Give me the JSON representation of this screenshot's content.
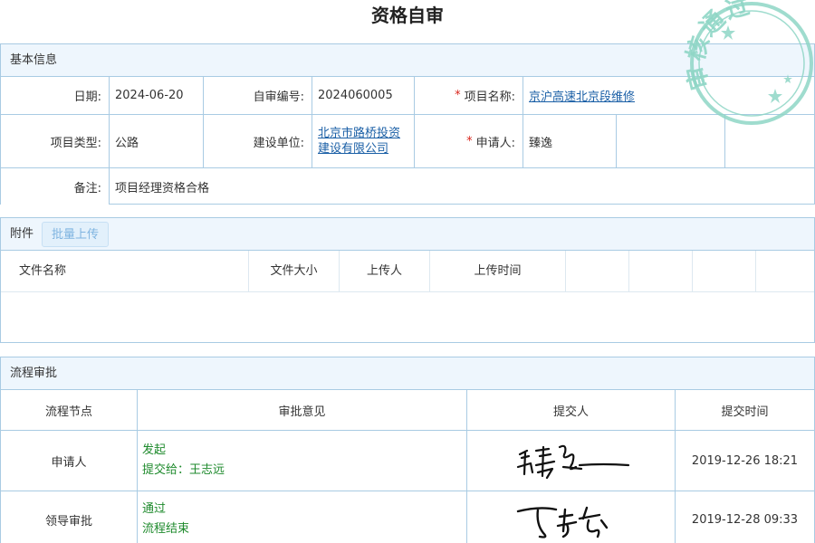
{
  "page": {
    "title": "资格自审"
  },
  "basic_info": {
    "header": "基本信息",
    "date_label": "日期:",
    "date_value": "2024-06-20",
    "code_label": "自审编号:",
    "code_value": "2024060005",
    "project_name_label": "项目名称:",
    "project_name_value": "京沪高速北京段维修",
    "project_type_label": "项目类型:",
    "project_type_value": "公路",
    "builder_label": "建设单位:",
    "builder_value": "北京市路桥投资建设有限公司",
    "applicant_label": "申请人:",
    "applicant_value": "臻逸",
    "remark_label": "备注:",
    "remark_value": "项目经理资格合格",
    "required_mark": "*"
  },
  "attachments": {
    "header": "附件",
    "upload_button": "批量上传",
    "columns": [
      "文件名称",
      "文件大小",
      "上传人",
      "上传时间"
    ]
  },
  "flow": {
    "header": "流程审批",
    "columns": [
      "流程节点",
      "审批意见",
      "提交人",
      "提交时间"
    ],
    "rows": [
      {
        "node": "申请人",
        "opinion_line1": "发起",
        "opinion_line2": "提交给：王志远",
        "time": "2019-12-26 18:21"
      },
      {
        "node": "领导审批",
        "opinion_line1": "通过",
        "opinion_line2": "流程结束",
        "time": "2019-12-28 09:33"
      }
    ]
  },
  "stamp": {
    "text": "审核通过",
    "color": "#7fd0bf"
  },
  "colors": {
    "border": "#a9cbe3",
    "header_bg": "#eef6fd",
    "link": "#1a5fa6",
    "green": "#1e8a2c",
    "required": "#d9251c"
  }
}
